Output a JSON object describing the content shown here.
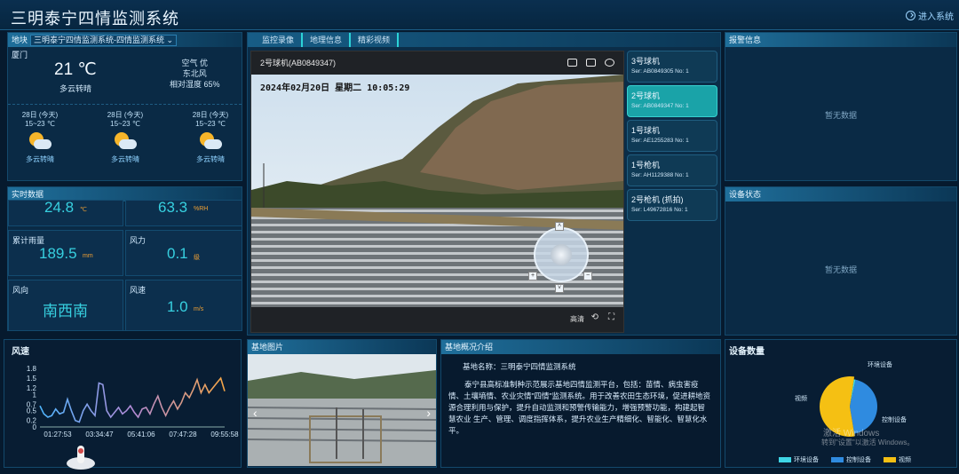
{
  "header": {
    "title": "三明泰宁四情监测系统",
    "enter_label": "进入系统"
  },
  "weather": {
    "loc_label": "地块",
    "loc_value": "三明泰宁四情监测系统-四情监测系统",
    "city": "厦门",
    "temp": "21 ℃",
    "condition": "多云转晴",
    "air": "空气 优",
    "wind": "东北风",
    "humidity": "相对湿度 65%",
    "forecast": [
      {
        "date": "28日 (今天)",
        "range": "15~23 ℃",
        "cond": "多云转晴"
      },
      {
        "date": "28日 (今天)",
        "range": "15~23 ℃",
        "cond": "多云转晴"
      },
      {
        "date": "28日 (今天)",
        "range": "15~23 ℃",
        "cond": "多云转晴"
      }
    ]
  },
  "realtime": {
    "title": "实时数据",
    "cells": [
      {
        "label": "",
        "value": "24.8",
        "unit": "℃"
      },
      {
        "label": "",
        "value": "63.3",
        "unit": "%RH"
      },
      {
        "label": "累计雨量",
        "value": "189.5",
        "unit": "mm"
      },
      {
        "label": "风力",
        "value": "0.1",
        "unit": "级"
      },
      {
        "label": "风向",
        "value": "南西南",
        "unit": ""
      },
      {
        "label": "风速",
        "value": "1.0",
        "unit": "m/s"
      }
    ]
  },
  "video": {
    "tabs": [
      "监控录像",
      "地理信息",
      "精彩视频"
    ],
    "camera_title": "2号球机(AB0849347)",
    "osd": "2024年02月20日  星期二  10:05:29",
    "quality": "高清"
  },
  "cameras": [
    {
      "name": "3号球机",
      "serial": "Ser: AB0849305 No: 1",
      "selected": false
    },
    {
      "name": "2号球机",
      "serial": "Ser: AB0849347 No: 1",
      "selected": true
    },
    {
      "name": "1号球机",
      "serial": "Ser: AE1255283 No: 1",
      "selected": false
    },
    {
      "name": "1号枪机",
      "serial": "Ser: AH1129388 No: 1",
      "selected": false
    },
    {
      "name": "2号枪机 (抓拍)",
      "serial": "Ser: L49672816 No: 1",
      "selected": false
    }
  ],
  "alarm": {
    "title": "报警信息",
    "empty": "暂无数据"
  },
  "device_status": {
    "title": "设备状态",
    "empty": "暂无数据"
  },
  "wind_chart": {
    "title": "风速"
  },
  "base_photo": {
    "title": "基地图片"
  },
  "intro": {
    "title": "基地概况介绍",
    "name_line": "基地名称：三明泰宁四情监测系统",
    "body": "泰宁县高标准制种示范展示基地四情监测平台，包括：苗情、病虫害疫情、土壤墒情、农业灾情\"四情\"监测系统。用于改善农田生态环境，促进耕地资源合理利用与保护，提升自动监测和预警传输能力，增强预警功能，构建起智慧农业 生产、管理、调度指挥体系，提升农业生产精细化、智能化、智慧化水平。"
  },
  "device_count": {
    "title": "设备数量",
    "legend": [
      "环境设备",
      "控制设备",
      "视频"
    ],
    "watermark_1": "激活 Windows",
    "watermark_2": "转到\"设置\"以激活 Windows。"
  },
  "chart_data": [
    {
      "type": "line",
      "title": "风速",
      "x_ticks": [
        "01:27:53",
        "03:34:47",
        "05:41:06",
        "07:47:28",
        "09:55:58"
      ],
      "y_ticks": [
        "0",
        "0.2",
        "0.5",
        "0.7",
        "1",
        "1.2",
        "1.5",
        "1.8"
      ],
      "ylim": [
        0,
        1.8
      ],
      "values": [
        0.65,
        0.4,
        0.3,
        0.35,
        0.55,
        0.4,
        0.45,
        0.85,
        0.5,
        0.2,
        0.15,
        0.5,
        0.7,
        0.5,
        0.35,
        1.35,
        1.3,
        0.5,
        0.3,
        0.45,
        0.6,
        0.4,
        0.5,
        0.65,
        0.45,
        0.3,
        0.55,
        0.6,
        0.4,
        0.7,
        0.95,
        0.6,
        0.35,
        0.6,
        0.8,
        0.55,
        0.75,
        1.05,
        0.9,
        1.15,
        1.45,
        1.05,
        1.3,
        1.05,
        1.2,
        1.35,
        1.5,
        1.1
      ]
    },
    {
      "type": "pie",
      "title": "设备数量",
      "labels": [
        "环境设备",
        "控制设备",
        "视频"
      ],
      "values": [
        1,
        44,
        55
      ],
      "colors": [
        "#3fd6e6",
        "#2f8be0",
        "#f5c013"
      ]
    }
  ]
}
